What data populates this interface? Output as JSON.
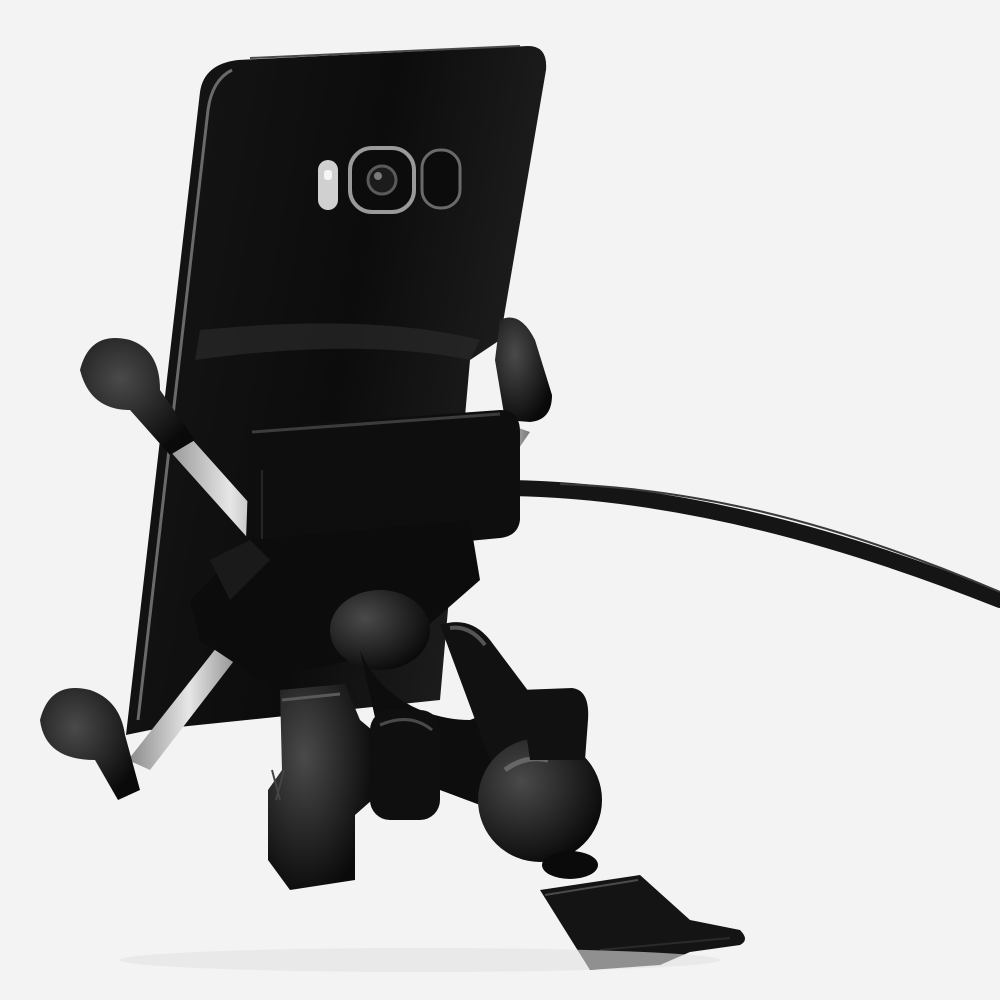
{
  "image": {
    "background": "#f3f3f3",
    "subject": "phone-holder-mount",
    "colors": {
      "body_black": "#0d0d0d",
      "phone_glass": "#111111",
      "highlight": "#5a5a5a",
      "metal": "#c8c8c8",
      "cable": "#151515"
    }
  }
}
